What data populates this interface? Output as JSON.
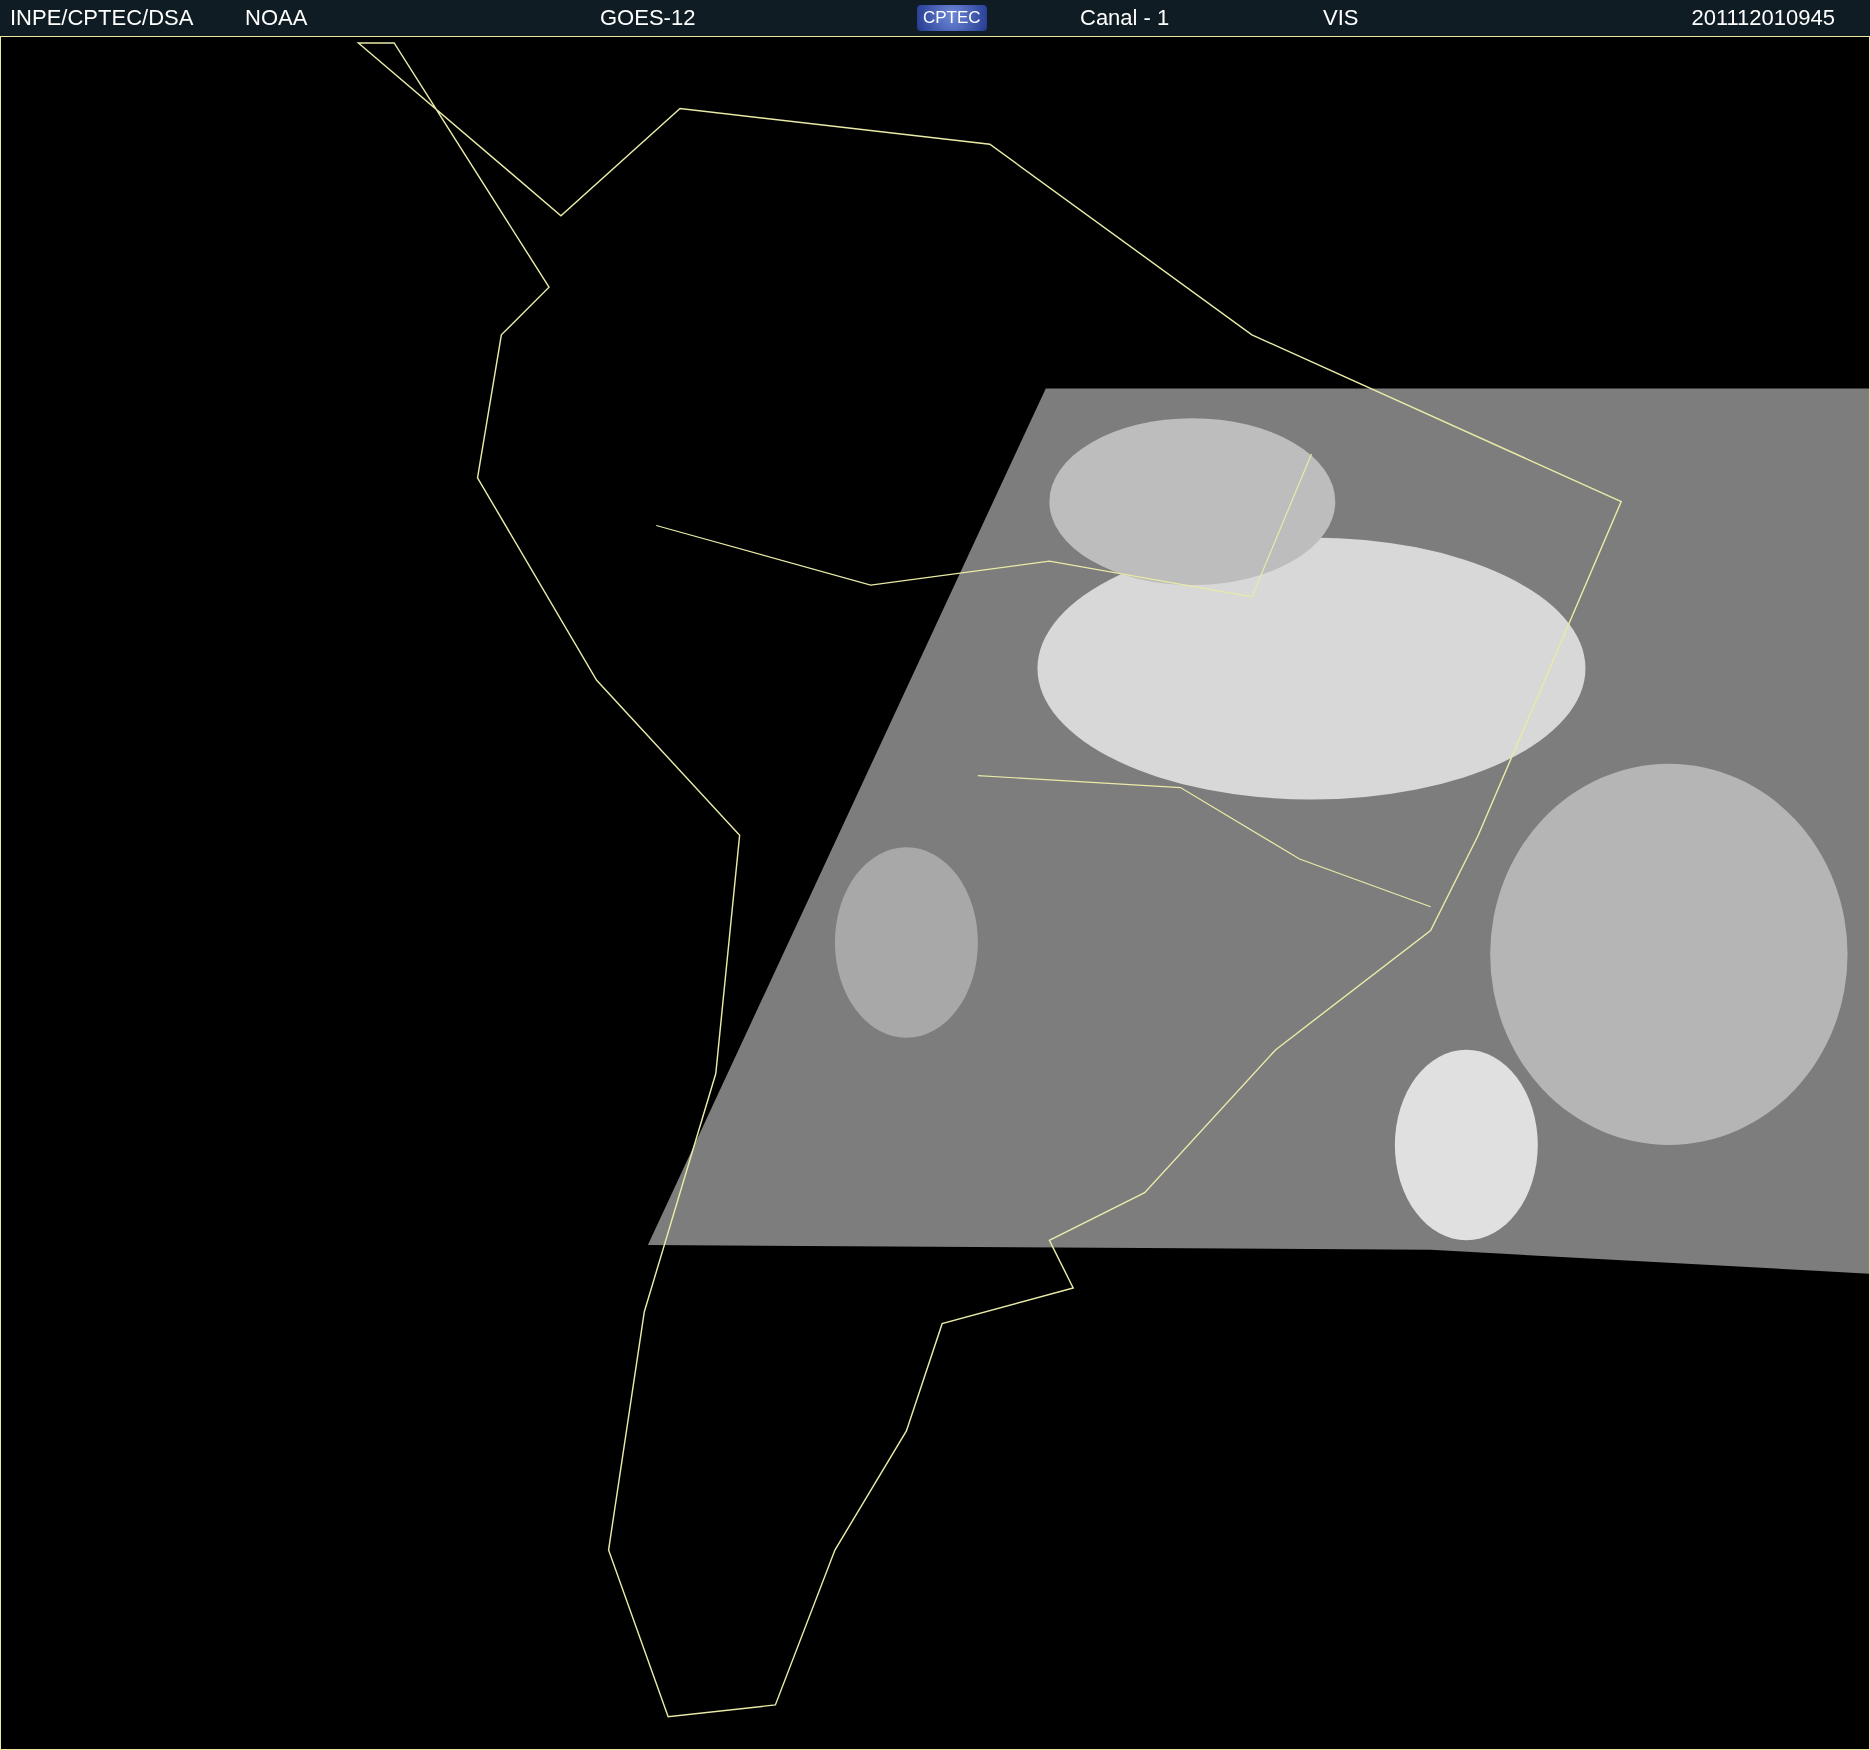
{
  "header": {
    "items": [
      {
        "kind": "text",
        "text": "INPE/CPTEC/DSA"
      },
      {
        "kind": "text",
        "text": "NOAA"
      },
      {
        "kind": "text",
        "text": "GOES-12"
      },
      {
        "kind": "logo",
        "text": "CPTEC"
      },
      {
        "kind": "text",
        "text": "Canal - 1"
      },
      {
        "kind": "text",
        "text": "VIS"
      },
      {
        "kind": "text",
        "text": "201112010945"
      }
    ]
  }
}
